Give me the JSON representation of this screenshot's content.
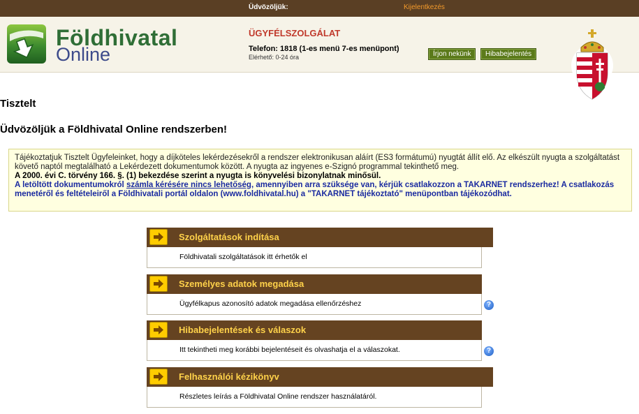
{
  "topbar": {
    "welcome": "Üdvözöljük:",
    "logout": "Kijelentkezés"
  },
  "header": {
    "logo_line1": "Földhivatal",
    "logo_line2": "Online",
    "cs_title": "ÜGYFÉLSZOLGÁLAT",
    "phone": "Telefon: 1818 (1-es menü 7-es menüpont)",
    "hours": "Elérhető: 0-24 óra",
    "write_button": "Írjon nekünk",
    "bug_button": "Hibabejelentés"
  },
  "greeting": "Tisztelt",
  "welcome_title": "Üdvözöljük a Földhivatal Online rendszerben!",
  "notice": {
    "p1": "Tájékoztatjuk Tisztelt Ügyfeleinket, hogy a díjköteles lekérdezésekről a rendszer elektronikusan aláírt (ES3 formátumú) nyugtát állít elő. Az elkészült nyugta a szolgáltatást követő naptól megtalálható a Lekérdezett dokumentumok között. A nyugta az ingyenes e-Szignó programmal tekinthető meg.",
    "p2": "A 2000. évi C. törvény 166. §. (1) bekezdése szerint a nyugta is könyvelési bizonylatnak minősül.",
    "p3a": "A letöltött dokumentumokról ",
    "p3b": "számla kérésére nincs lehetőség",
    "p3c": ", amennyiben arra szüksége van, kérjük csatlakozzon a TAKARNET rendszerhez! A csatlakozás menetéről és feltételeiről a Földhivatali portál oldalon (www.foldhivatal.hu) a \"TAKARNET tájékoztató\" menüpontban tájékozódhat."
  },
  "cards": [
    {
      "title": "Szolgáltatások indítása",
      "desc": "Földhivatali szolgáltatások itt érhetők el"
    },
    {
      "title": "Személyes adatok megadása",
      "desc": "Ügyfélkapus azonosító adatok megadása ellenőrzéshez"
    },
    {
      "title": "Hibabejelentések és válaszok",
      "desc": "Itt tekintheti meg korábbi bejelentéseit és olvashatja el a válaszokat."
    },
    {
      "title": "Felhasználói kézikönyv",
      "desc": "Részletes leírás a Földhivatal Online rendszer használatáról."
    }
  ],
  "colors": {
    "topbar": "#5a3f24",
    "card_bar": "#654321",
    "card_title": "#ffd24a",
    "accent_orange": "#f39a2b",
    "link_blue": "#1a2aa0"
  }
}
